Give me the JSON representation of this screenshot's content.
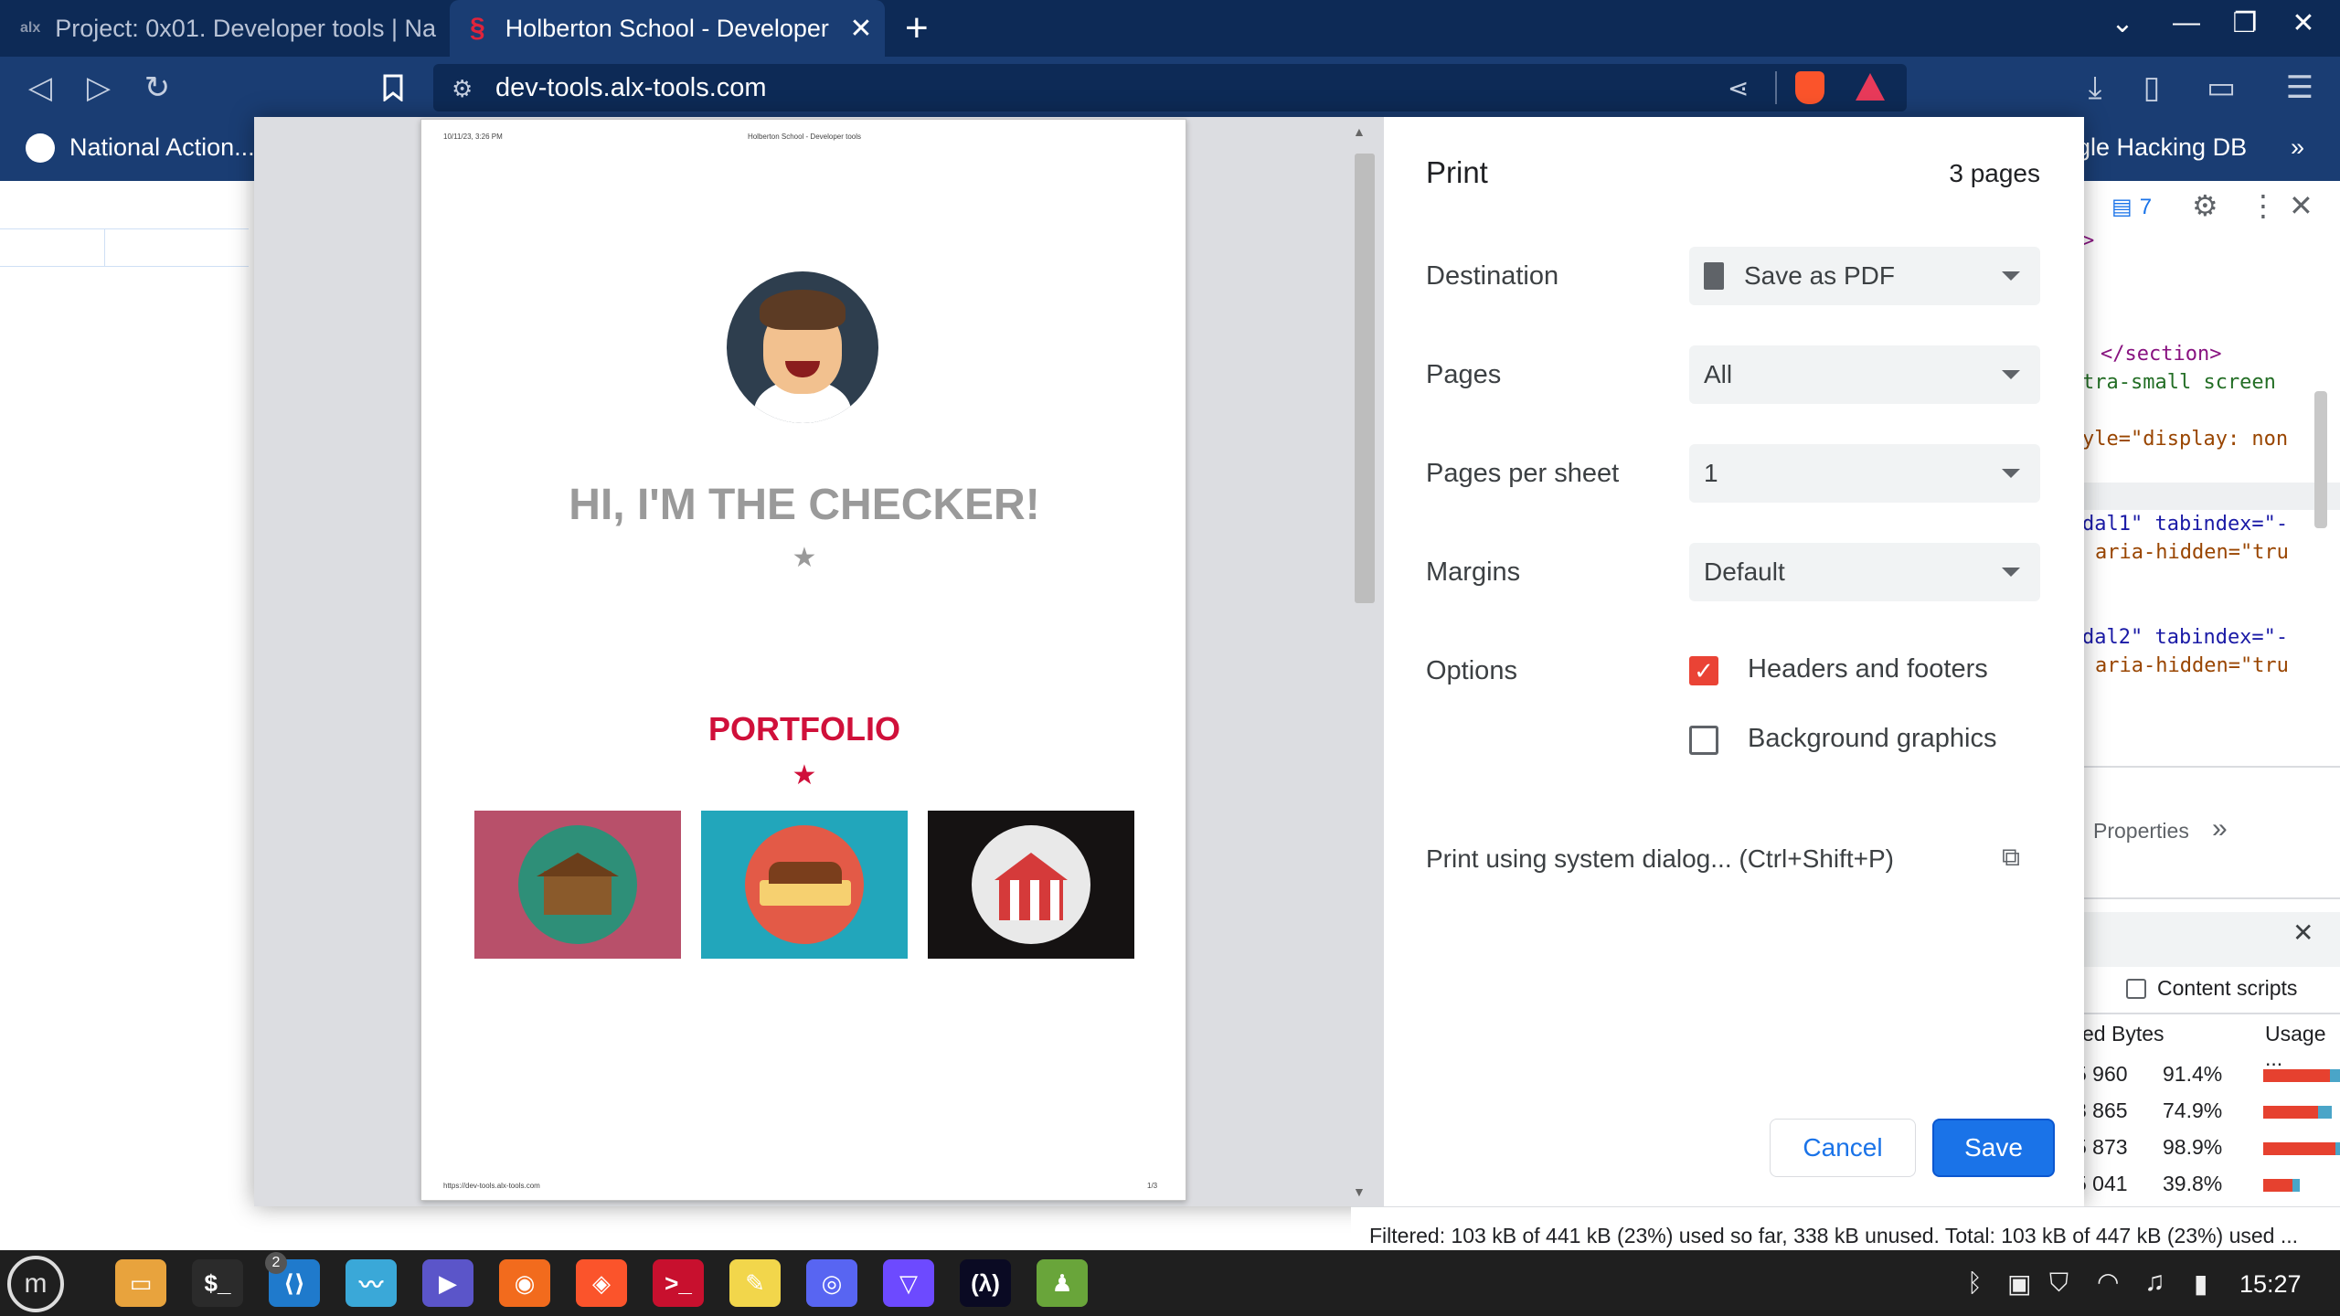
{
  "browser": {
    "tabs": [
      {
        "favicon": "alx",
        "title": "Project: 0x01. Developer tools | Na"
      },
      {
        "favicon": "holberton-icon",
        "title": "Holberton School - Developer"
      }
    ],
    "url": "dev-tools.alx-tools.com",
    "bookmarks": {
      "left": "National Action...",
      "right": "gle Hacking DB"
    }
  },
  "print_preview": {
    "header_date": "10/11/23, 3:26 PM",
    "header_title": "Holberton School - Developer tools",
    "hero_title": "HI, I'M THE CHECKER!",
    "portfolio_title": "PORTFOLIO",
    "footer_url": "https://dev-tools.alx-tools.com",
    "footer_page": "1/3"
  },
  "print": {
    "title": "Print",
    "page_count": "3 pages",
    "destination_label": "Destination",
    "destination_value": "Save as PDF",
    "pages_label": "Pages",
    "pages_value": "All",
    "pps_label": "Pages per sheet",
    "pps_value": "1",
    "margins_label": "Margins",
    "margins_value": "Default",
    "options_label": "Options",
    "opt_headers": "Headers and footers",
    "opt_headers_checked": true,
    "opt_background": "Background graphics",
    "opt_background_checked": false,
    "system_dialog": "Print using system dialog... (Ctrl+Shift+P)",
    "cancel_label": "Cancel",
    "save_label": "Save"
  },
  "devtools": {
    "issue_count": "7",
    "code_lines": [
      ">",
      "</section>",
      "tra-small screen",
      "yle=\"display: non",
      "dal1\" tabindex=\"-",
      "aria-hidden=\"tru",
      "dal2\" tabindex=\"-",
      "aria-hidden=\"tru"
    ],
    "properties_tab": "Properties",
    "content_scripts": "Content scripts",
    "col_bytes": "ed Bytes",
    "col_usage": "Usage ...",
    "rows": [
      {
        "bytes": "5 960",
        "pct": "91.4%",
        "frac": 0.914
      },
      {
        "bytes": "3 865",
        "pct": "74.9%",
        "frac": 0.749
      },
      {
        "bytes": "5 873",
        "pct": "98.9%",
        "frac": 0.989
      },
      {
        "bytes": "5 041",
        "pct": "39.8%",
        "frac": 0.398
      }
    ],
    "status": "Filtered: 103 kB of 441 kB (23%) used so far, 338 kB unused. Total: 103 kB of 447 kB (23%) used ..."
  },
  "taskbar": {
    "clock": "15:27",
    "vscode_badge": "2",
    "apps": [
      "files-icon",
      "terminal-icon",
      "vscode-icon",
      "system-monitor-icon",
      "media-player-icon",
      "firefox-icon",
      "brave-icon",
      "terminal-red-icon",
      "notes-icon",
      "discord-icon",
      "proton-vpn-icon",
      "freecodecamp-icon",
      "chess-icon"
    ]
  },
  "colors": {
    "accent_blue": "#1a73e8",
    "chrome_dark": "#0d2a56",
    "chrome": "#1a3d73",
    "portfolio_red": "#d0103a"
  }
}
